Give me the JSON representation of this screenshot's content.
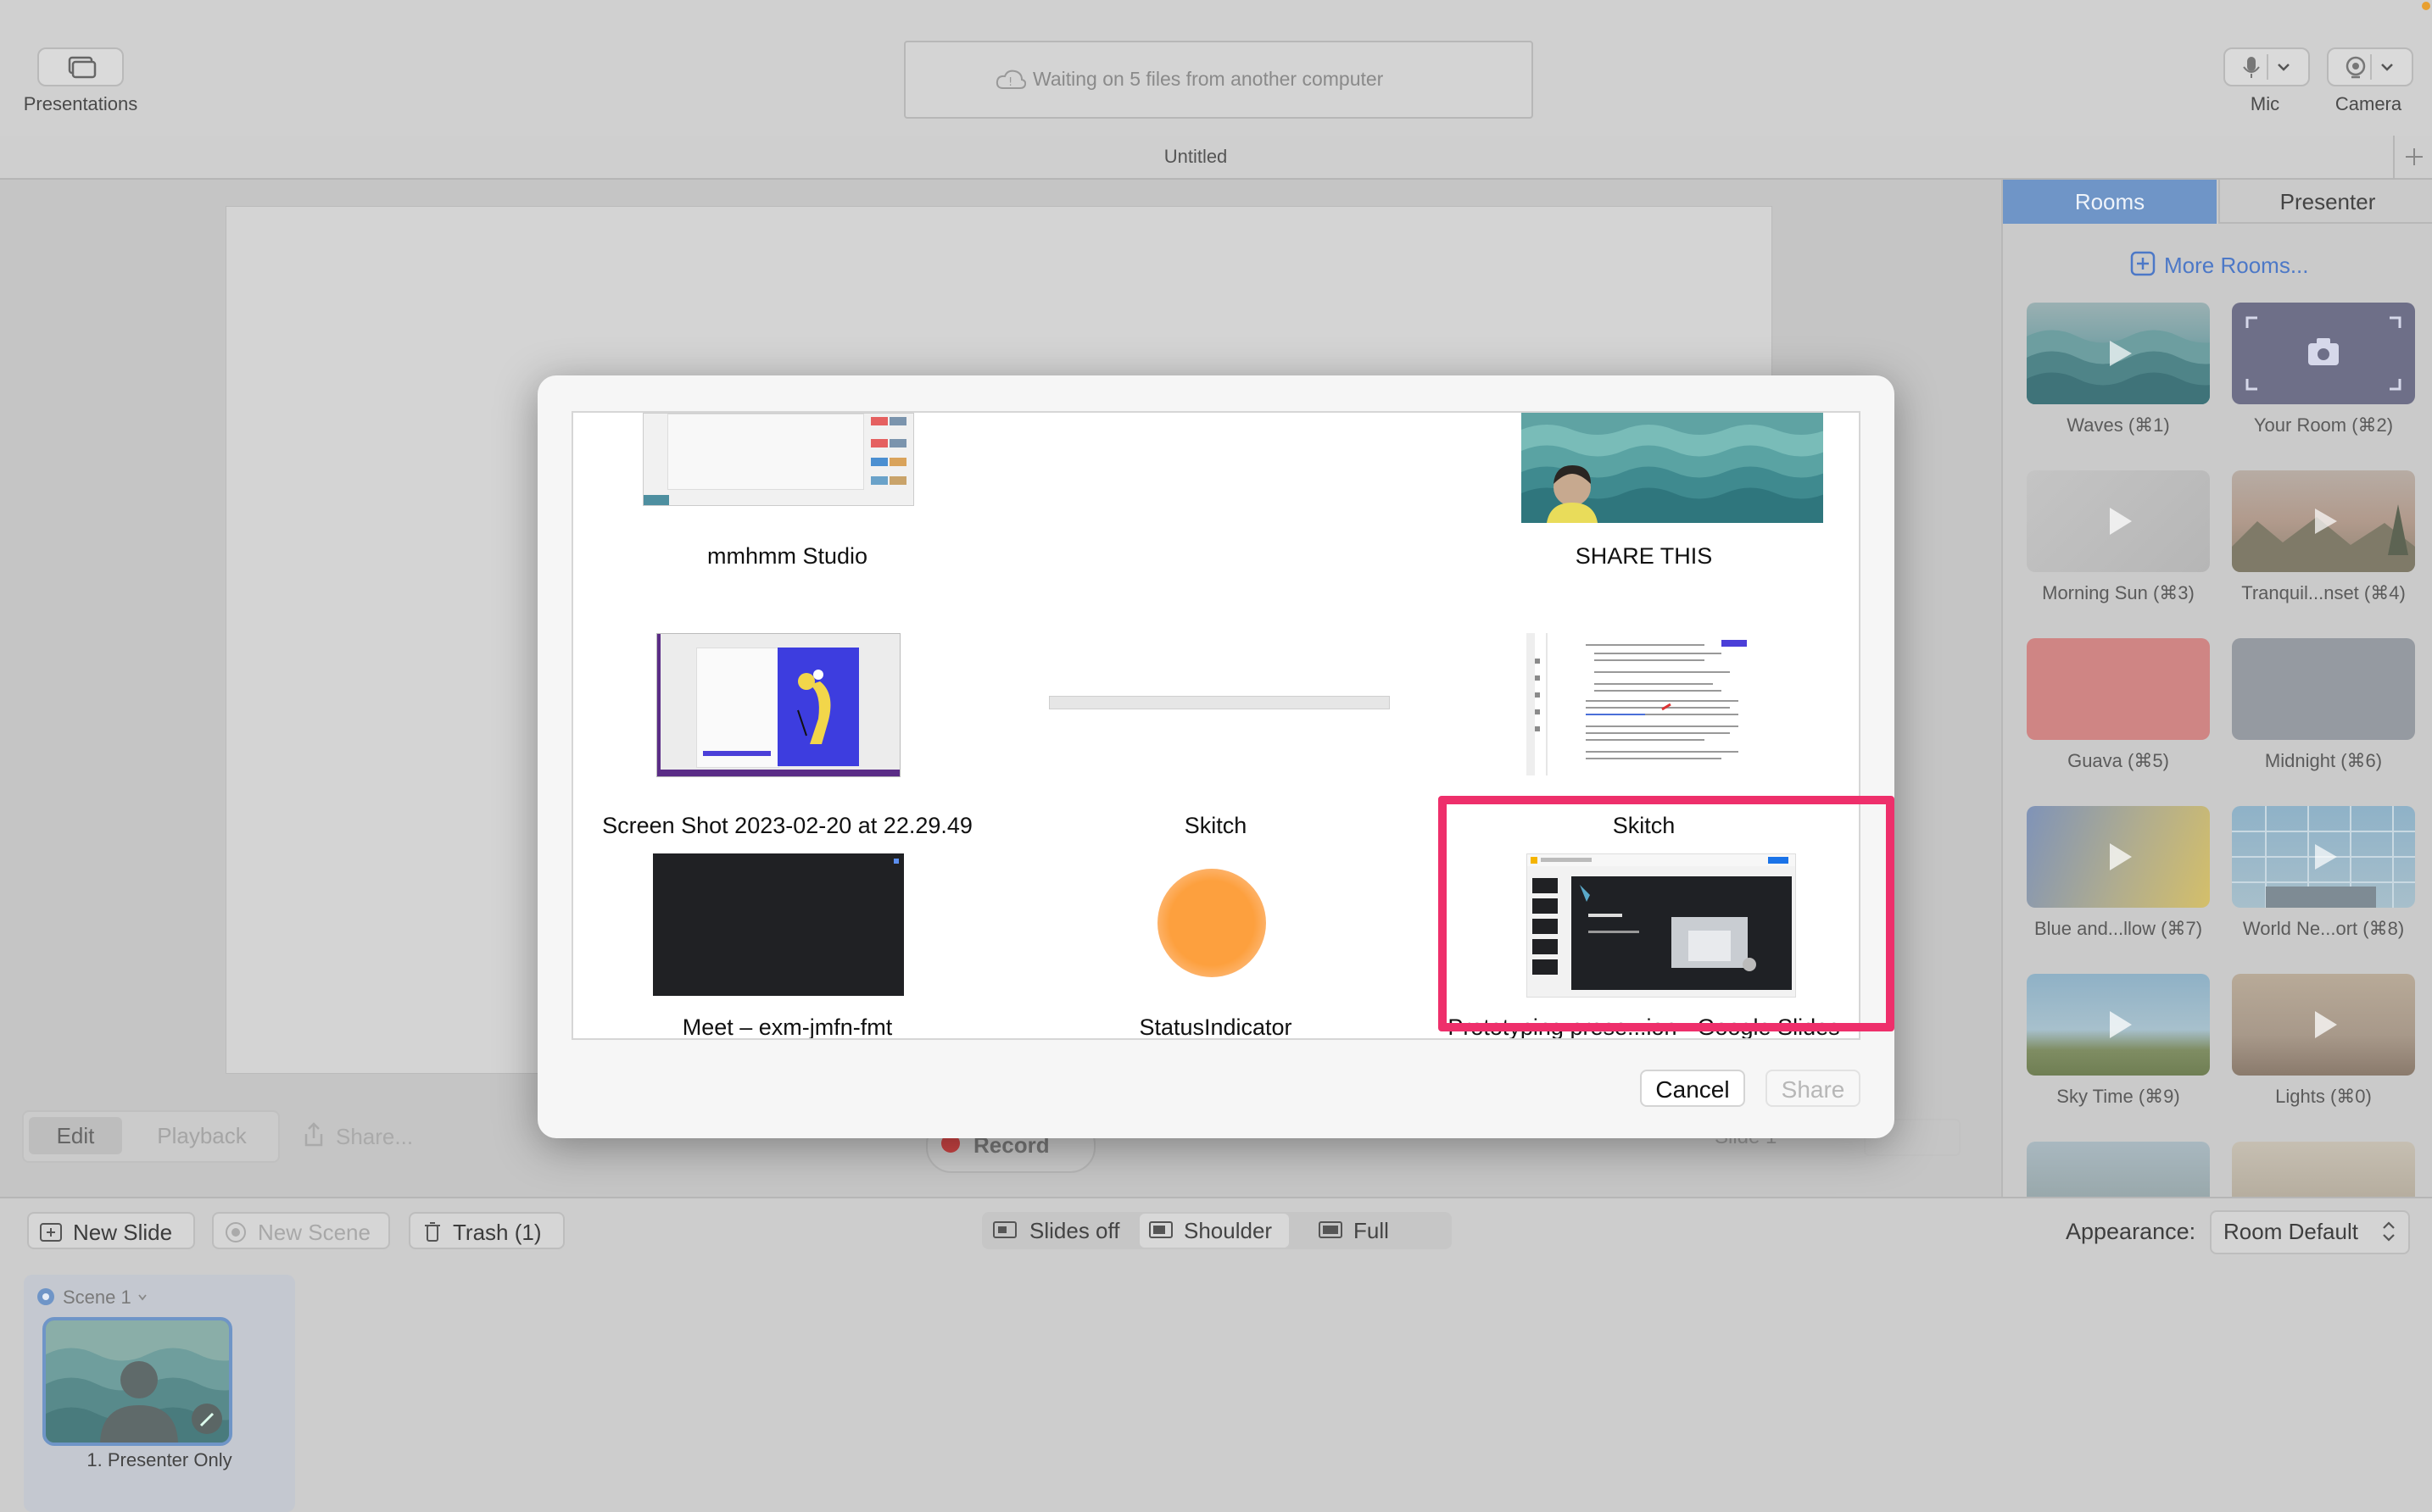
{
  "toolbar": {
    "presentations_label": "Presentations",
    "status_text": "Waiting on 5 files from another computer",
    "mic_label": "Mic",
    "camera_label": "Camera"
  },
  "document_title": "Untitled",
  "right_panel": {
    "tabs": [
      "Rooms",
      "Presenter"
    ],
    "more_rooms": "More Rooms...",
    "rooms": [
      {
        "name": "Waves (⌘1)"
      },
      {
        "name": "Your Room (⌘2)"
      },
      {
        "name": "Morning Sun (⌘3)"
      },
      {
        "name": "Tranquil...nset (⌘4)"
      },
      {
        "name": "Guava (⌘5)"
      },
      {
        "name": "Midnight (⌘6)"
      },
      {
        "name": "Blue and...llow (⌘7)"
      },
      {
        "name": "World Ne...ort (⌘8)"
      },
      {
        "name": "Sky Time (⌘9)"
      },
      {
        "name": "Lights (⌘0)"
      }
    ]
  },
  "playbar": {
    "edit": "Edit",
    "playback": "Playback",
    "share": "Share...",
    "record": "Record",
    "slide_indicator": "Slide 1"
  },
  "bottombar": {
    "new_slide": "New Slide",
    "new_scene": "New Scene",
    "trash": "Trash (1)",
    "slides_off": "Slides off",
    "shoulder": "Shoulder",
    "full": "Full",
    "appearance_label": "Appearance:",
    "appearance_value": "Room Default"
  },
  "scenes": {
    "scene_label": "Scene 1",
    "slide_caption": "1. Presenter Only"
  },
  "dialog": {
    "items": [
      {
        "label": "mmhmm Studio"
      },
      {
        "label": ""
      },
      {
        "label": "SHARE THIS"
      },
      {
        "label": "Screen Shot 2023-02-20 at 22.29.49"
      },
      {
        "label": "Skitch"
      },
      {
        "label": "Skitch"
      },
      {
        "label": "Meet – exm-jmfn-fmt"
      },
      {
        "label": "StatusIndicator"
      },
      {
        "label": "Prototyping prese...ion - Google Slides"
      }
    ],
    "cancel": "Cancel",
    "share": "Share"
  },
  "colors": {
    "highlight": "#ee2f6b",
    "rooms_tab_active": "#6f95c7",
    "more_rooms": "#4c78c7"
  }
}
